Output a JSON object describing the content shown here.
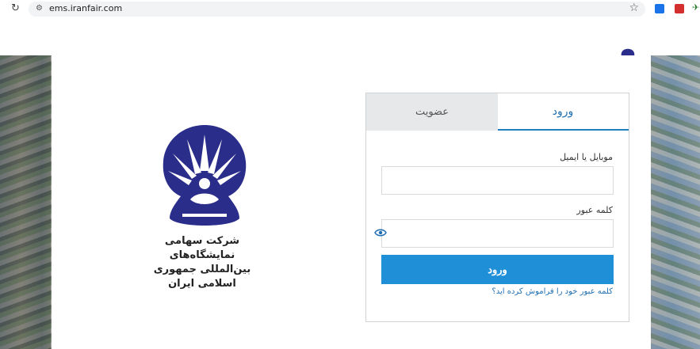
{
  "browser": {
    "url": "ems.iranfair.com",
    "icons": [
      "reload-icon",
      "tune-icon",
      "bookmark-star-icon",
      "download-extension-icon",
      "pdf-extension-icon",
      "extension-icon"
    ]
  },
  "brand": {
    "logo_icon": "iranfair-logo-icon",
    "logo_color": "#2b2d8a",
    "company_name_line1": "شرکت سهامی نمایشگاه‌های",
    "company_name_line2": "بین‌المللی جمهوری اسلامی ایران"
  },
  "tabs": {
    "login": "ورود",
    "register": "عضویت",
    "active": "login"
  },
  "form": {
    "mobile_label": "موبایل یا ایمیل",
    "mobile_value": "",
    "password_label": "کلمه عبور",
    "password_value": "",
    "submit_label": "ورود",
    "forgot_link": "کلمه عبور خود را فراموش کرده اید؟"
  },
  "colors": {
    "accent": "#1f8fd8",
    "tab_active_text": "#1f6fb2",
    "tab_inactive_bg": "#e7e8e9"
  }
}
